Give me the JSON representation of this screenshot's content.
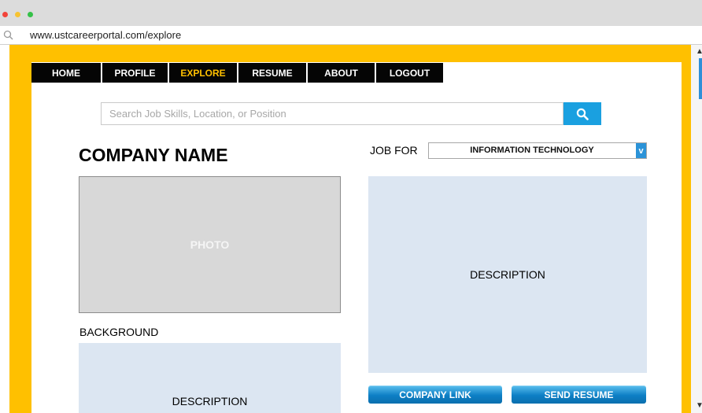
{
  "browser": {
    "url": "www.ustcareerportal.com/explore"
  },
  "nav": {
    "items": [
      {
        "label": "HOME"
      },
      {
        "label": "PROFILE"
      },
      {
        "label": "EXPLORE",
        "active": true
      },
      {
        "label": "RESUME"
      },
      {
        "label": "ABOUT"
      },
      {
        "label": "LOGOUT"
      }
    ],
    "active_color": "#ffc000"
  },
  "search": {
    "placeholder": "Search Job Skills, Location, or Position",
    "value": "",
    "icon": "search-icon"
  },
  "company": {
    "name": "COMPANY NAME",
    "photo_label": "PHOTO",
    "background_label": "BACKGROUND",
    "background_description": "DESCRIPTION"
  },
  "job": {
    "label": "JOB FOR",
    "selected": "INFORMATION TECHNOLOGY",
    "dropdown_icon_text": "v",
    "description": "DESCRIPTION"
  },
  "actions": {
    "company_link": "COMPANY LINK",
    "send_resume": "SEND RESUME"
  },
  "colors": {
    "frame": "#ffc000",
    "accent": "#1aa0e0",
    "panel": "#dce6f2",
    "photo": "#d8d8d8"
  }
}
